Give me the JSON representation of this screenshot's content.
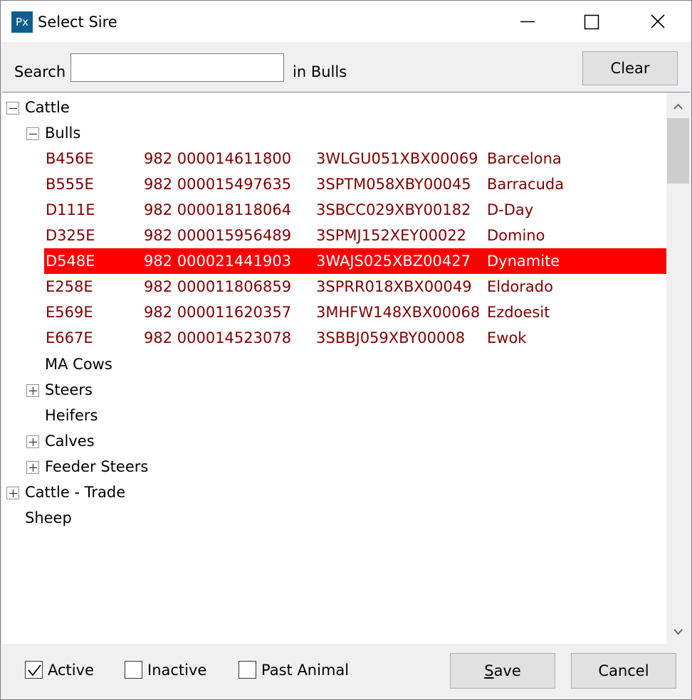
{
  "window": {
    "icon_text": "Px",
    "title": "Select Sire"
  },
  "search": {
    "label": "Search",
    "value": "",
    "placeholder": "",
    "scope": "in Bulls",
    "clear_label": "Clear"
  },
  "tree": {
    "root": {
      "label": "Cattle",
      "expanded": true
    },
    "bulls": {
      "label": "Bulls",
      "expanded": true
    },
    "animals": [
      {
        "tag": "B456E",
        "eid": "982 000014611800",
        "reg": "3WLGU051XBX00069",
        "name": "Barcelona",
        "selected": false
      },
      {
        "tag": "B555E",
        "eid": "982 000015497635",
        "reg": "3SPTM058XBY00045",
        "name": "Barracuda",
        "selected": false
      },
      {
        "tag": "D111E",
        "eid": "982 000018118064",
        "reg": "3SBCC029XBY00182",
        "name": "D-Day",
        "selected": false
      },
      {
        "tag": "D325E",
        "eid": "982 000015956489",
        "reg": "3SPMJ152XEY00022",
        "name": "Domino",
        "selected": false
      },
      {
        "tag": "D548E",
        "eid": "982 000021441903",
        "reg": "3WAJS025XBZ00427",
        "name": "Dynamite",
        "selected": true
      },
      {
        "tag": "E258E",
        "eid": "982 000011806859",
        "reg": "3SPRR018XBX00049",
        "name": "Eldorado",
        "selected": false
      },
      {
        "tag": "E569E",
        "eid": "982 000011620357",
        "reg": "3MHFW148XBX00068",
        "name": "Ezdoesit",
        "selected": false
      },
      {
        "tag": "E667E",
        "eid": "982 000014523078",
        "reg": "3SBBJ059XBY00008",
        "name": "Ewok",
        "selected": false
      }
    ],
    "ma_cows": {
      "label": "MA Cows"
    },
    "steers": {
      "label": "Steers",
      "expanded": false
    },
    "heifers": {
      "label": "Heifers"
    },
    "calves": {
      "label": "Calves",
      "expanded": false
    },
    "feeder_steers": {
      "label": "Feeder Steers",
      "expanded": false
    },
    "cattle_trade": {
      "label": "Cattle - Trade",
      "expanded": false
    },
    "sheep": {
      "label": "Sheep"
    }
  },
  "filters": {
    "active": {
      "label": "Active",
      "checked": true
    },
    "inactive": {
      "label": "Inactive",
      "checked": false
    },
    "past": {
      "label": "Past Animal",
      "checked": false
    }
  },
  "buttons": {
    "save_first": "S",
    "save_rest": "ave",
    "cancel": "Cancel"
  },
  "colors": {
    "animal_text": "#800000",
    "selection": "#ff0000",
    "app_icon": "#0e5d8f"
  },
  "icons": {
    "minimize": "minimize-icon",
    "maximize": "maximize-icon",
    "close": "close-icon",
    "collapse": "minus-icon",
    "expand": "plus-icon",
    "check": "checkmark-icon",
    "scroll_up": "chevron-up-icon",
    "scroll_down": "chevron-down-icon"
  }
}
